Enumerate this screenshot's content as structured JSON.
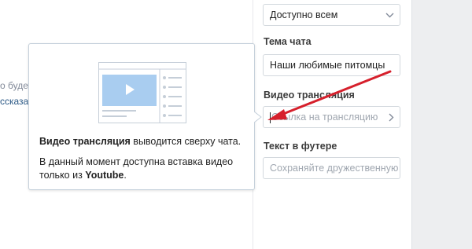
{
  "left_partial": {
    "line1": "о будет",
    "line2": "ссказа"
  },
  "settings": {
    "visibility_select": {
      "value": "Доступно всем"
    },
    "chat_topic": {
      "label": "Тема чата",
      "value": "Наши любимые питомцы"
    },
    "video_stream": {
      "label": "Видео трансляция",
      "placeholder": "Ссылка на трансляцию"
    },
    "footer_text": {
      "label": "Текст в футере",
      "placeholder": "Сохраняйте дружественную а"
    }
  },
  "tooltip": {
    "line1_bold": "Видео трансляция",
    "line1_rest": " выводится сверху чата.",
    "line2": "В данный момент доступна вставка видео",
    "line3_prefix": "только из ",
    "line3_bold": "Youtube",
    "line3_suffix": "."
  },
  "colors": {
    "annotation_arrow": "#d6202c",
    "video_preview": "#a9cdf0",
    "border": "#d3d9de"
  },
  "icons": [
    "chevron-down-icon",
    "chevron-right-icon",
    "video-preview-icon",
    "red-arrow-annotation"
  ]
}
